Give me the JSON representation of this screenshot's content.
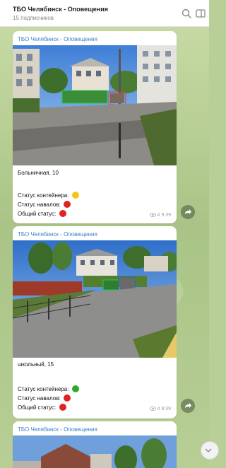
{
  "header": {
    "title": "ТБО Челябинск - Оповещения",
    "subscribers": "15 подписчиков"
  },
  "messages": [
    {
      "channel": "ТБО Челябинск - Оповещения",
      "address": "Больничная, 10",
      "container_label": "Статус контейнера:",
      "dump_label": "Статус навалов:",
      "overall_label": "Общий статус:",
      "container_color": "#f5c518",
      "dump_color": "#e02424",
      "overall_color": "#e02424",
      "views": "4",
      "time": "9:39"
    },
    {
      "channel": "ТБО Челябинск - Оповещения",
      "address": "школьный, 15",
      "container_label": "Статус контейнера:",
      "dump_label": "Статус навалов:",
      "overall_label": "Общий статус:",
      "container_color": "#2ea82e",
      "dump_color": "#e02424",
      "overall_color": "#e02424",
      "views": "4",
      "time": "9:39"
    },
    {
      "channel": "ТБО Челябинск - Оповещения"
    }
  ]
}
